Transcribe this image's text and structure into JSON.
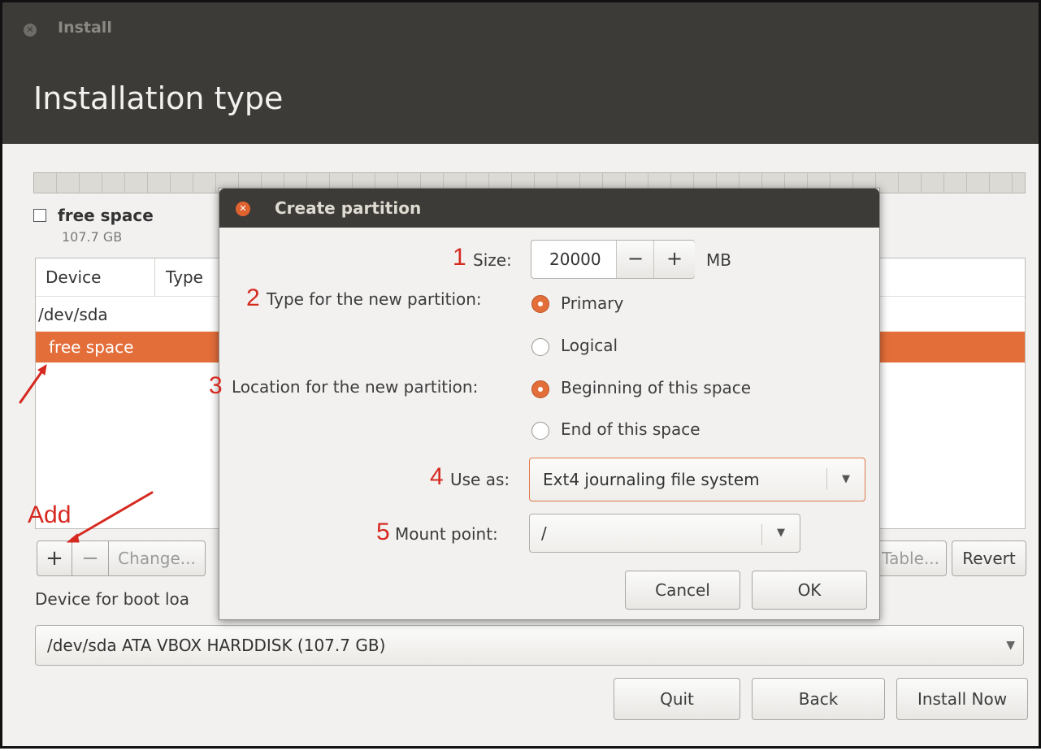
{
  "window": {
    "title": "Install",
    "page_title": "Installation type"
  },
  "partitions": {
    "free_space_label": "free space",
    "free_space_size": "107.7 GB",
    "columns": [
      "Device",
      "Type"
    ],
    "rows": [
      {
        "device": "/dev/sda"
      },
      {
        "device": "free space",
        "selected": true
      }
    ]
  },
  "toolbar": {
    "add": "+",
    "remove": "−",
    "change": "Change...",
    "new_table": "Table...",
    "revert": "Revert"
  },
  "boot_loader": {
    "label": "Device for boot loa",
    "value": "/dev/sda  ATA VBOX HARDDISK (107.7 GB)"
  },
  "footer": {
    "quit": "Quit",
    "back": "Back",
    "install_now": "Install Now"
  },
  "dialog": {
    "title": "Create partition",
    "size_label": "Size:",
    "size_value": "20000",
    "size_minus": "−",
    "size_plus": "+",
    "size_unit": "MB",
    "type_label": "Type for the new partition:",
    "type_options": [
      {
        "label": "Primary",
        "selected": true
      },
      {
        "label": "Logical",
        "selected": false
      }
    ],
    "location_label": "Location for the new partition:",
    "location_options": [
      {
        "label": "Beginning of this space",
        "selected": true
      },
      {
        "label": "End of this space",
        "selected": false
      }
    ],
    "use_as_label": "Use as:",
    "use_as_value": "Ext4 journaling file system",
    "mount_label": "Mount point:",
    "mount_value": "/",
    "cancel": "Cancel",
    "ok": "OK"
  },
  "annotations": {
    "numbers": [
      "1",
      "2",
      "3",
      "4",
      "5"
    ],
    "add_text": "Add",
    "color": "#d62920"
  },
  "colors": {
    "accent": "#e46e3a",
    "titlebar": "#3c3b37",
    "background": "#f2f1f0"
  }
}
